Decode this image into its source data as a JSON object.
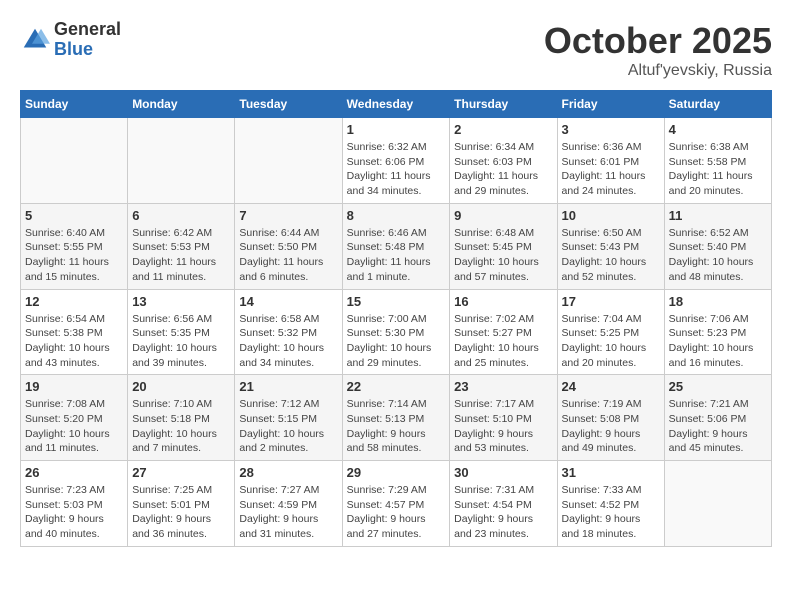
{
  "header": {
    "logo_general": "General",
    "logo_blue": "Blue",
    "month_title": "October 2025",
    "location": "Altuf'yevskiy, Russia"
  },
  "weekdays": [
    "Sunday",
    "Monday",
    "Tuesday",
    "Wednesday",
    "Thursday",
    "Friday",
    "Saturday"
  ],
  "weeks": [
    [
      {
        "day": "",
        "info": ""
      },
      {
        "day": "",
        "info": ""
      },
      {
        "day": "",
        "info": ""
      },
      {
        "day": "1",
        "info": "Sunrise: 6:32 AM\nSunset: 6:06 PM\nDaylight: 11 hours\nand 34 minutes."
      },
      {
        "day": "2",
        "info": "Sunrise: 6:34 AM\nSunset: 6:03 PM\nDaylight: 11 hours\nand 29 minutes."
      },
      {
        "day": "3",
        "info": "Sunrise: 6:36 AM\nSunset: 6:01 PM\nDaylight: 11 hours\nand 24 minutes."
      },
      {
        "day": "4",
        "info": "Sunrise: 6:38 AM\nSunset: 5:58 PM\nDaylight: 11 hours\nand 20 minutes."
      }
    ],
    [
      {
        "day": "5",
        "info": "Sunrise: 6:40 AM\nSunset: 5:55 PM\nDaylight: 11 hours\nand 15 minutes."
      },
      {
        "day": "6",
        "info": "Sunrise: 6:42 AM\nSunset: 5:53 PM\nDaylight: 11 hours\nand 11 minutes."
      },
      {
        "day": "7",
        "info": "Sunrise: 6:44 AM\nSunset: 5:50 PM\nDaylight: 11 hours\nand 6 minutes."
      },
      {
        "day": "8",
        "info": "Sunrise: 6:46 AM\nSunset: 5:48 PM\nDaylight: 11 hours\nand 1 minute."
      },
      {
        "day": "9",
        "info": "Sunrise: 6:48 AM\nSunset: 5:45 PM\nDaylight: 10 hours\nand 57 minutes."
      },
      {
        "day": "10",
        "info": "Sunrise: 6:50 AM\nSunset: 5:43 PM\nDaylight: 10 hours\nand 52 minutes."
      },
      {
        "day": "11",
        "info": "Sunrise: 6:52 AM\nSunset: 5:40 PM\nDaylight: 10 hours\nand 48 minutes."
      }
    ],
    [
      {
        "day": "12",
        "info": "Sunrise: 6:54 AM\nSunset: 5:38 PM\nDaylight: 10 hours\nand 43 minutes."
      },
      {
        "day": "13",
        "info": "Sunrise: 6:56 AM\nSunset: 5:35 PM\nDaylight: 10 hours\nand 39 minutes."
      },
      {
        "day": "14",
        "info": "Sunrise: 6:58 AM\nSunset: 5:32 PM\nDaylight: 10 hours\nand 34 minutes."
      },
      {
        "day": "15",
        "info": "Sunrise: 7:00 AM\nSunset: 5:30 PM\nDaylight: 10 hours\nand 29 minutes."
      },
      {
        "day": "16",
        "info": "Sunrise: 7:02 AM\nSunset: 5:27 PM\nDaylight: 10 hours\nand 25 minutes."
      },
      {
        "day": "17",
        "info": "Sunrise: 7:04 AM\nSunset: 5:25 PM\nDaylight: 10 hours\nand 20 minutes."
      },
      {
        "day": "18",
        "info": "Sunrise: 7:06 AM\nSunset: 5:23 PM\nDaylight: 10 hours\nand 16 minutes."
      }
    ],
    [
      {
        "day": "19",
        "info": "Sunrise: 7:08 AM\nSunset: 5:20 PM\nDaylight: 10 hours\nand 11 minutes."
      },
      {
        "day": "20",
        "info": "Sunrise: 7:10 AM\nSunset: 5:18 PM\nDaylight: 10 hours\nand 7 minutes."
      },
      {
        "day": "21",
        "info": "Sunrise: 7:12 AM\nSunset: 5:15 PM\nDaylight: 10 hours\nand 2 minutes."
      },
      {
        "day": "22",
        "info": "Sunrise: 7:14 AM\nSunset: 5:13 PM\nDaylight: 9 hours\nand 58 minutes."
      },
      {
        "day": "23",
        "info": "Sunrise: 7:17 AM\nSunset: 5:10 PM\nDaylight: 9 hours\nand 53 minutes."
      },
      {
        "day": "24",
        "info": "Sunrise: 7:19 AM\nSunset: 5:08 PM\nDaylight: 9 hours\nand 49 minutes."
      },
      {
        "day": "25",
        "info": "Sunrise: 7:21 AM\nSunset: 5:06 PM\nDaylight: 9 hours\nand 45 minutes."
      }
    ],
    [
      {
        "day": "26",
        "info": "Sunrise: 7:23 AM\nSunset: 5:03 PM\nDaylight: 9 hours\nand 40 minutes."
      },
      {
        "day": "27",
        "info": "Sunrise: 7:25 AM\nSunset: 5:01 PM\nDaylight: 9 hours\nand 36 minutes."
      },
      {
        "day": "28",
        "info": "Sunrise: 7:27 AM\nSunset: 4:59 PM\nDaylight: 9 hours\nand 31 minutes."
      },
      {
        "day": "29",
        "info": "Sunrise: 7:29 AM\nSunset: 4:57 PM\nDaylight: 9 hours\nand 27 minutes."
      },
      {
        "day": "30",
        "info": "Sunrise: 7:31 AM\nSunset: 4:54 PM\nDaylight: 9 hours\nand 23 minutes."
      },
      {
        "day": "31",
        "info": "Sunrise: 7:33 AM\nSunset: 4:52 PM\nDaylight: 9 hours\nand 18 minutes."
      },
      {
        "day": "",
        "info": ""
      }
    ]
  ]
}
